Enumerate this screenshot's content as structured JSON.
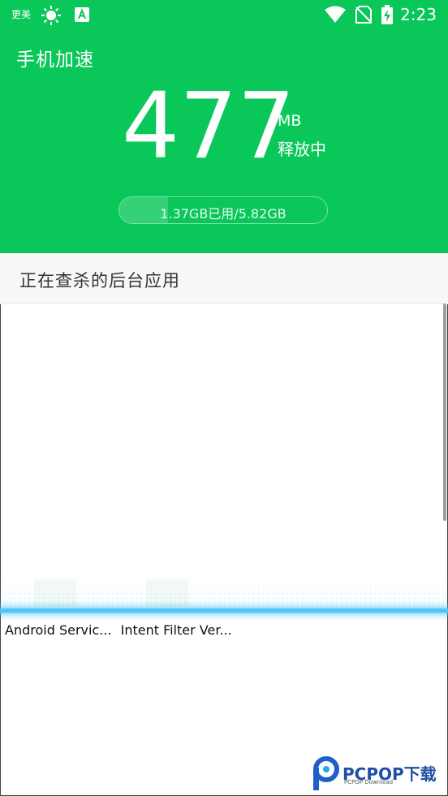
{
  "status_bar": {
    "left_text": "更美",
    "time": "2:23",
    "icons": [
      "weather-sun-icon",
      "app-a-icon",
      "wifi-icon",
      "no-sim-icon",
      "battery-charging-icon"
    ]
  },
  "header": {
    "title": "手机加速",
    "freed_value": "477",
    "freed_unit": "MB",
    "freed_status": "释放中",
    "memory_text": "1.37GB已用/5.82GB",
    "memory_used_fraction": 0.235
  },
  "section": {
    "title": "正在查杀的后台应用"
  },
  "apps": [
    "Android Servic...",
    "Intent Filter Ver..."
  ],
  "watermark": {
    "text": "PCPOP下载",
    "sub": "PCPOP Download"
  },
  "colors": {
    "header_bg": "#0ac759",
    "scan_line": "#4fc6f5"
  }
}
